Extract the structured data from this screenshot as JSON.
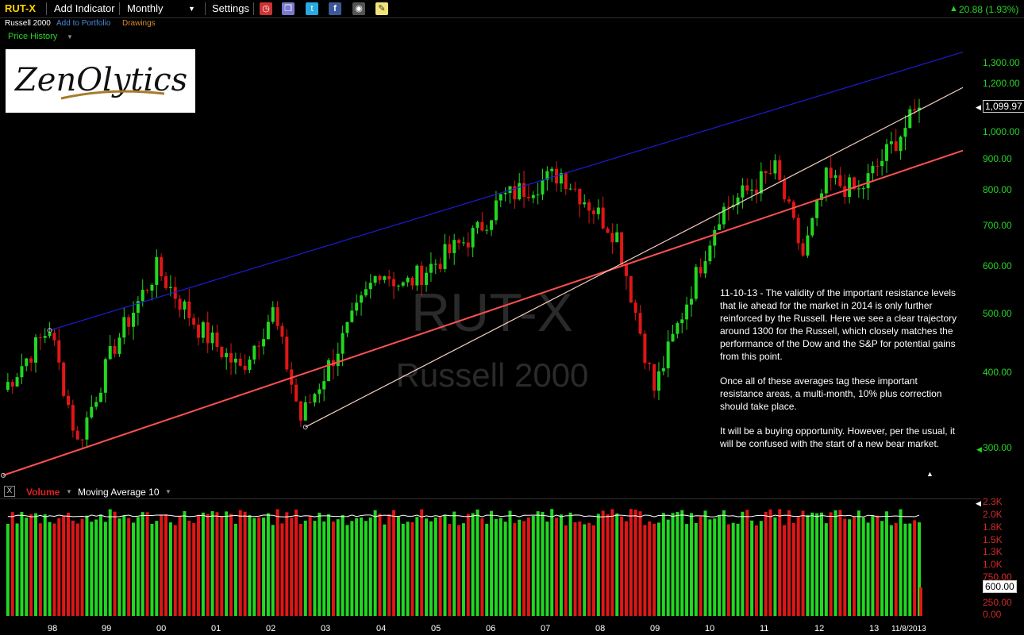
{
  "toolbar": {
    "symbol": "RUT-X",
    "add_indicator": "Add Indicator",
    "period": "Monthly",
    "settings": "Settings",
    "change": "20.88 (1.93%)"
  },
  "subline": {
    "name": "Russell 2000",
    "add_portfolio": "Add to Portfolio",
    "drawings": "Drawings"
  },
  "panel": {
    "price_history": "Price History"
  },
  "logo": {
    "text": "ZenOlytics"
  },
  "watermark": {
    "symbol": "RUT-X",
    "name": "Russell 2000"
  },
  "annotation": {
    "p1": "11-10-13 - The validity of the important resistance levels that lie ahead for the market in 2014 is only further reinforced by the Russell. Here we see a clear trajectory around 1300 for the Russell, which closely matches the performance of the Dow and the S&P for potential gains from this point.",
    "p2": "Once all of these averages tag these important resistance areas, a multi-month, 10% plus correction should take place.",
    "p3": "It will be a buying opportunity. However, per the usual, it will be confused with the start of a new bear market."
  },
  "price_axis": [
    "1,300.00",
    "1,200.00",
    "1,000.00",
    "900.00",
    "800.00",
    "700.00",
    "600.00",
    "500.00",
    "400.00",
    "300.00"
  ],
  "last_price": "1,099.97",
  "volume": {
    "label": "Volume",
    "ma_label": "Moving Average 10",
    "close_icon": "X",
    "axis": [
      "2.3K",
      "2.0K",
      "1.8K",
      "1.5K",
      "1.3K",
      "1.0K",
      "750.00",
      "500.00",
      "250.00",
      "0.00"
    ],
    "last": "600.00"
  },
  "x_axis": [
    "98",
    "99",
    "00",
    "01",
    "02",
    "03",
    "04",
    "05",
    "06",
    "07",
    "08",
    "09",
    "10",
    "11",
    "12",
    "13",
    "11/8/2013"
  ],
  "colors": {
    "up": "#22d722",
    "down": "#e01616",
    "resistance": "#1c1cd6",
    "support": "#ff5050",
    "trend": "#f5d0c0",
    "axis_green": "#27d327"
  },
  "chart_data": {
    "type": "candlestick",
    "scale": "log",
    "ylim": [
      270,
      1400
    ],
    "x_range": [
      "1997-06",
      "2013-11"
    ],
    "monthly_close_waypoints": [
      {
        "date": "1997-06",
        "value": 380
      },
      {
        "date": "1998-04",
        "value": 480
      },
      {
        "date": "1998-10",
        "value": 310
      },
      {
        "date": "1999-06",
        "value": 450
      },
      {
        "date": "2000-03",
        "value": 600
      },
      {
        "date": "2000-12",
        "value": 480
      },
      {
        "date": "2001-09",
        "value": 410
      },
      {
        "date": "2002-04",
        "value": 510
      },
      {
        "date": "2002-10",
        "value": 340
      },
      {
        "date": "2004-03",
        "value": 600
      },
      {
        "date": "2004-08",
        "value": 560
      },
      {
        "date": "2005-12",
        "value": 690
      },
      {
        "date": "2006-05",
        "value": 780
      },
      {
        "date": "2007-06",
        "value": 860
      },
      {
        "date": "2008-06",
        "value": 680
      },
      {
        "date": "2009-02",
        "value": 380
      },
      {
        "date": "2010-04",
        "value": 740
      },
      {
        "date": "2011-04",
        "value": 870
      },
      {
        "date": "2011-10",
        "value": 630
      },
      {
        "date": "2012-03",
        "value": 840
      },
      {
        "date": "2012-10",
        "value": 800
      },
      {
        "date": "2013-11",
        "value": 1099.97
      }
    ],
    "trendlines": [
      {
        "name": "resistance",
        "color": "blue",
        "from": {
          "date": "1998-04",
          "value": 475
        },
        "to": {
          "date": "2013-11",
          "value": 1290
        }
      },
      {
        "name": "support",
        "color": "red",
        "from": {
          "date": "1997-06",
          "value": 275
        },
        "to": {
          "date": "2013-11",
          "value": 885
        }
      },
      {
        "name": "trend",
        "color": "cream",
        "from": {
          "date": "2002-11",
          "value": 330
        },
        "to": {
          "date": "2013-11",
          "value": 1090
        }
      }
    ],
    "volume_scale": [
      0,
      2300
    ]
  }
}
